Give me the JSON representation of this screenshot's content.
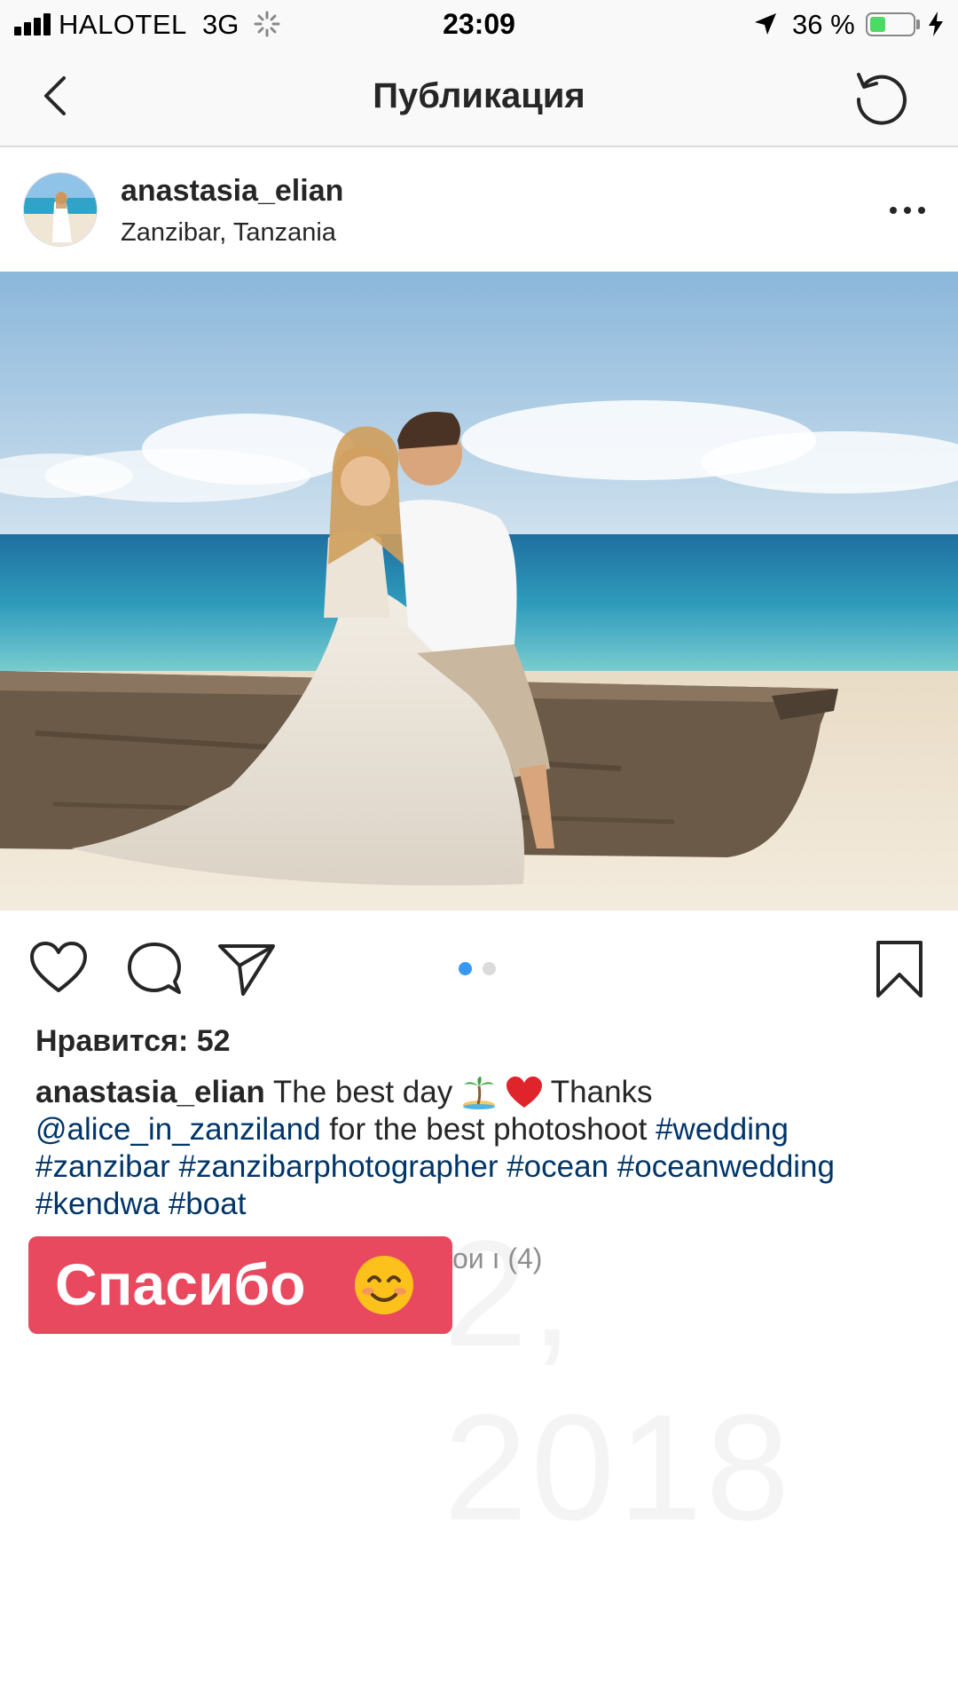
{
  "status_bar": {
    "carrier": "HALOTEL",
    "network": "3G",
    "time": "23:09",
    "battery_percent": "36 %",
    "battery_level": 0.36
  },
  "nav": {
    "title": "Публикация"
  },
  "post": {
    "username": "anastasia_elian",
    "location": "Zanzibar, Tanzania",
    "likes": "Нравится: 52",
    "carousel_total": 2,
    "carousel_active": 1,
    "caption": {
      "user": "anastasia_elian",
      "text1": "The best day",
      "text2": "Thanks",
      "mention": "@alice_in_zanziland",
      "text3": "for the best photoshoot",
      "tags": [
        "#wedding",
        "#zanzibar",
        "#zanzibarphotographer",
        "#ocean",
        "#oceanwedding",
        "#kendwa",
        "#boat"
      ]
    },
    "comments_partial": "ои ı (4)",
    "date_ghost": "2, 2018"
  },
  "sticker": {
    "label": "Спасибо"
  },
  "colors": {
    "link": "#003569",
    "sticker": "#e8495f",
    "battery": "#4cd964",
    "dot_active": "#3897f0",
    "dot_inactive": "#dbdbdb"
  }
}
